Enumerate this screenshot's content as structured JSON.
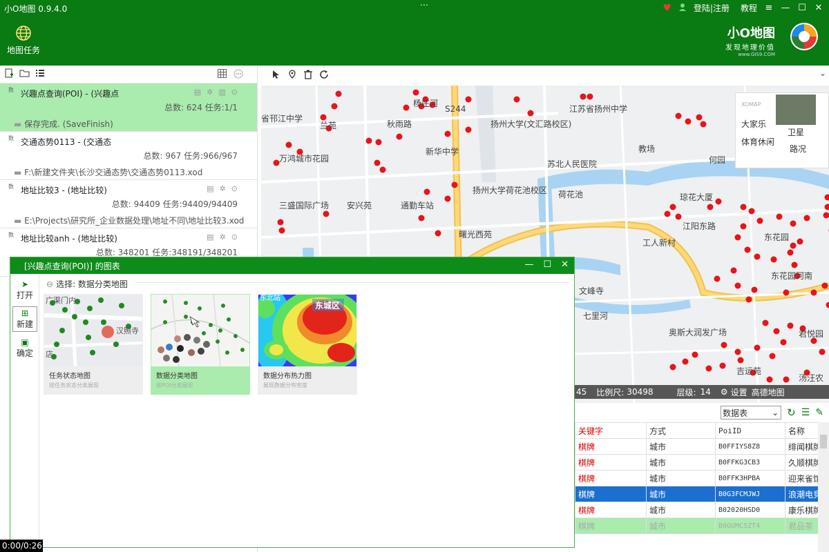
{
  "app": {
    "title": "小O地图 0.9.4.0",
    "drag_handle": "⋯"
  },
  "top_right": {
    "login": "登陆|注册",
    "tutorial": "教程"
  },
  "ribbon": {
    "map_task_label": "地图任务"
  },
  "brand": {
    "name": "小O地图",
    "slogan": "发现地理价值",
    "url": "www.GIS9.COM"
  },
  "tasks": [
    {
      "shu": "数",
      "name": "兴趣点查询(POI) - (兴趣点",
      "stats": "总数: 624 任务:1/1",
      "path": "保存完成. (SaveFinish)",
      "active": true
    },
    {
      "shu": "数",
      "name": "交通态势0113 - (交通态",
      "stats": "总数: 967 任务:966/967",
      "path": "F:\\新建文件夹\\长沙交通态势\\交通态势0113.xod",
      "active": false
    },
    {
      "shu": "数",
      "name": "地址比较3 - (地址比较)",
      "stats": "总数: 94409 任务:94409/94409",
      "path": "E:\\Projects\\研究所_企业数据处理\\地址不同\\地址比较3.xod",
      "active": false
    },
    {
      "shu": "数",
      "name": "地址比较anh - (地址比较)",
      "stats": "总数: 348201 任务:348191/348201",
      "path": "",
      "active": false
    }
  ],
  "map": {
    "labels": [
      "省邗江中学",
      "兰苑",
      "秋雨路",
      "杨庄河",
      "S244",
      "扬州大学(文汇路校区)",
      "江苏省扬州中学",
      "教场",
      "何园",
      "万鸿城市花园",
      "新华中学",
      "苏北人民医院",
      "荷花池",
      "扬州大学荷花池校区",
      "三盛国际广场",
      "安兴苑",
      "通勤车站",
      "琼花大厦",
      "江阳东路",
      "东花园",
      "工人新村",
      "曙光西苑",
      "东花园河南",
      "文峰寺",
      "七里河",
      "奥斯大润发广场",
      "吉运苑",
      "君悦园",
      "汤汪农",
      "大家乐",
      "体育休闲"
    ],
    "basemap": {
      "xomap": "XOMAP",
      "satellite": "卫星",
      "traffic": "路况"
    },
    "status": {
      "coord_tail": "45",
      "scale_label": "比例尺:",
      "scale": "30498",
      "level_label": "层级:",
      "level": "14",
      "settings": "设置",
      "provider": "高德地图"
    }
  },
  "grid": {
    "view_select": "数据表",
    "columns": [
      "关键字",
      "方式",
      "PoiID",
      "名称"
    ],
    "rows": [
      [
        "棋牌",
        "城市",
        "B0FFIYS8Z8",
        "绯闻棋牌"
      ],
      [
        "棋牌",
        "城市",
        "B0FFKG3CB3",
        "久顺棋牌"
      ],
      [
        "棋牌",
        "城市",
        "B0FFK3HPBA",
        "迎来雀馆"
      ],
      [
        "棋牌",
        "城市",
        "B0G3FCMJWJ",
        "浪潮电竞"
      ],
      [
        "棋牌",
        "城市",
        "B02020HSD0",
        "康乐棋牌"
      ],
      [
        "棋牌",
        "城市",
        "B0GUMC5ZT4",
        "君品茶"
      ]
    ],
    "selected_row": 3
  },
  "dialog": {
    "title": "[兴趣点查询(POI)] 的图表",
    "side": {
      "open": "打开",
      "new": "新建",
      "confirm": "确定"
    },
    "select_label": "选择: 数据分类地图",
    "cards": [
      {
        "title": "任务状态地图",
        "desc": "按任务状态分类展现",
        "thumb_label": "广渠门内",
        "thumb_label2": "汉照寺",
        "thumb_label3": "店"
      },
      {
        "title": "数据分类地图",
        "desc": "按POI分类展现"
      },
      {
        "title": "数据分布热力图",
        "desc": "展现数据分布密度",
        "thumb_label": "东城区",
        "thumb_label2": "东北站"
      }
    ]
  },
  "video": {
    "time": "0:00/0:26"
  },
  "colors": {
    "brand_green": "#0a7a12",
    "selected_green": "#a9ecae",
    "selected_blue": "#1a6fd0",
    "poi_red": "#e8141a"
  }
}
